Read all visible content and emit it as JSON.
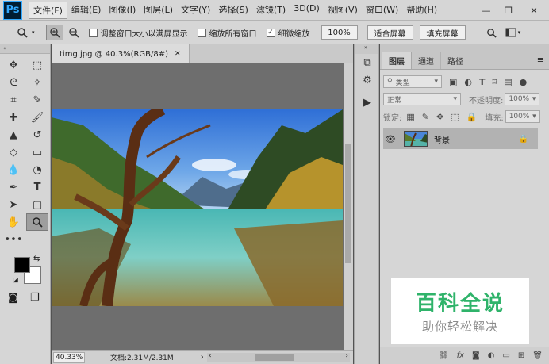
{
  "app": {
    "logo": "Ps"
  },
  "menu": [
    "文件(F)",
    "编辑(E)",
    "图像(I)",
    "图层(L)",
    "文字(Y)",
    "选择(S)",
    "滤镜(T)",
    "3D(D)",
    "视图(V)",
    "窗口(W)",
    "帮助(H)"
  ],
  "options": {
    "resize_windows": "调整窗口大小以满屏显示",
    "zoom_all": "缩放所有窗口",
    "scrubby_zoom": "细微缩放",
    "zoom_100": "100%",
    "fit_screen": "适合屏幕",
    "fill_screen": "填充屏幕"
  },
  "document": {
    "tab_title": "timg.jpg @ 40.3%(RGB/8#)",
    "zoom_level": "40.33%",
    "doc_info": "文档:2.31M/2.31M"
  },
  "layers_panel": {
    "tabs": [
      "图层",
      "通道",
      "路径"
    ],
    "filter_kind": "类型",
    "blend_mode": "正常",
    "opacity_label": "不透明度:",
    "opacity_value": "100%",
    "lock_label": "锁定:",
    "fill_label": "填充:",
    "fill_value": "100%",
    "layer_name": "背景"
  },
  "watermark": {
    "title": "百科全说",
    "subtitle": "助你轻松解决"
  },
  "colors": {
    "accent_green": "#2fb36a",
    "ps_blue": "#31a8ff",
    "ui_gray": "#d6d6d6"
  },
  "icons": {
    "zoom_tool": "magnifier-icon",
    "hand_tool": "hand-icon",
    "eye": "eye-icon",
    "lock": "lock-icon"
  }
}
